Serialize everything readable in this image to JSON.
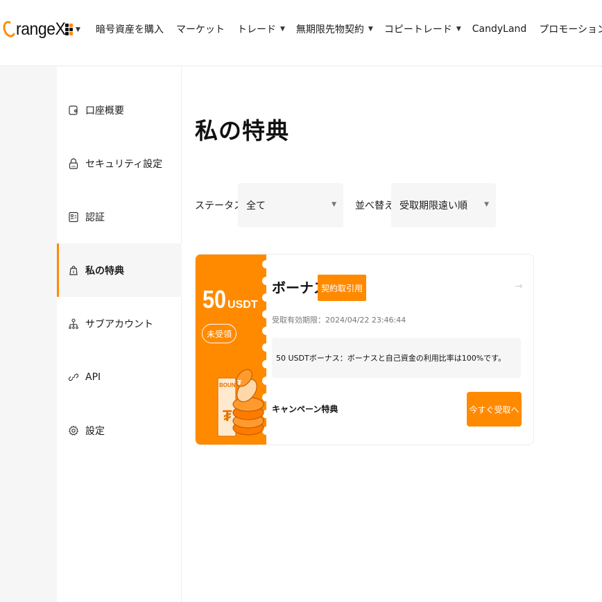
{
  "header": {
    "logo_text": "rangeX",
    "nav": [
      {
        "label": "暗号資産を購入",
        "dropdown": false
      },
      {
        "label": "マーケット",
        "dropdown": false
      },
      {
        "label": "トレード",
        "dropdown": true
      },
      {
        "label": "無期限先物契約",
        "dropdown": true
      },
      {
        "label": "コピートレード",
        "dropdown": true
      },
      {
        "label": "CandyLand",
        "dropdown": false
      },
      {
        "label": "プロモーション",
        "dropdown": true
      }
    ]
  },
  "sidebar": {
    "items": [
      {
        "label": "口座概要",
        "icon": "wallet-icon",
        "active": false
      },
      {
        "label": "セキュリティ設定",
        "icon": "lock-icon",
        "active": false
      },
      {
        "label": "認証",
        "icon": "id-card-icon",
        "active": false
      },
      {
        "label": "私の特典",
        "icon": "gift-icon",
        "active": true
      },
      {
        "label": "サブアカウント",
        "icon": "sub-account-icon",
        "active": false
      },
      {
        "label": "API",
        "icon": "link-icon",
        "active": false
      },
      {
        "label": "設定",
        "icon": "gear-icon",
        "active": false
      }
    ]
  },
  "main": {
    "title": "私の特典",
    "filters": {
      "status_label": "ステータス",
      "status_value": "全て",
      "sort_label": "並べ替え",
      "sort_value": "受取期限遠い順"
    },
    "card": {
      "amount": "50",
      "unit": "USDT",
      "status": "未受領",
      "title": "ボーナス",
      "tag": "契約取引用",
      "expiry": "受取有効期限：2024/04/22 23:46:44",
      "description": "50 USDTボーナス：ボーナスと自己資金の利用比率は100%です。",
      "campaign": "キャンペーン特典",
      "claim_button": "今すぐ受取へ",
      "illustration_text": "BOUN"
    }
  },
  "colors": {
    "accent": "#ff8a00",
    "panel": "#f6f6f6",
    "text": "#1a1a1a"
  }
}
